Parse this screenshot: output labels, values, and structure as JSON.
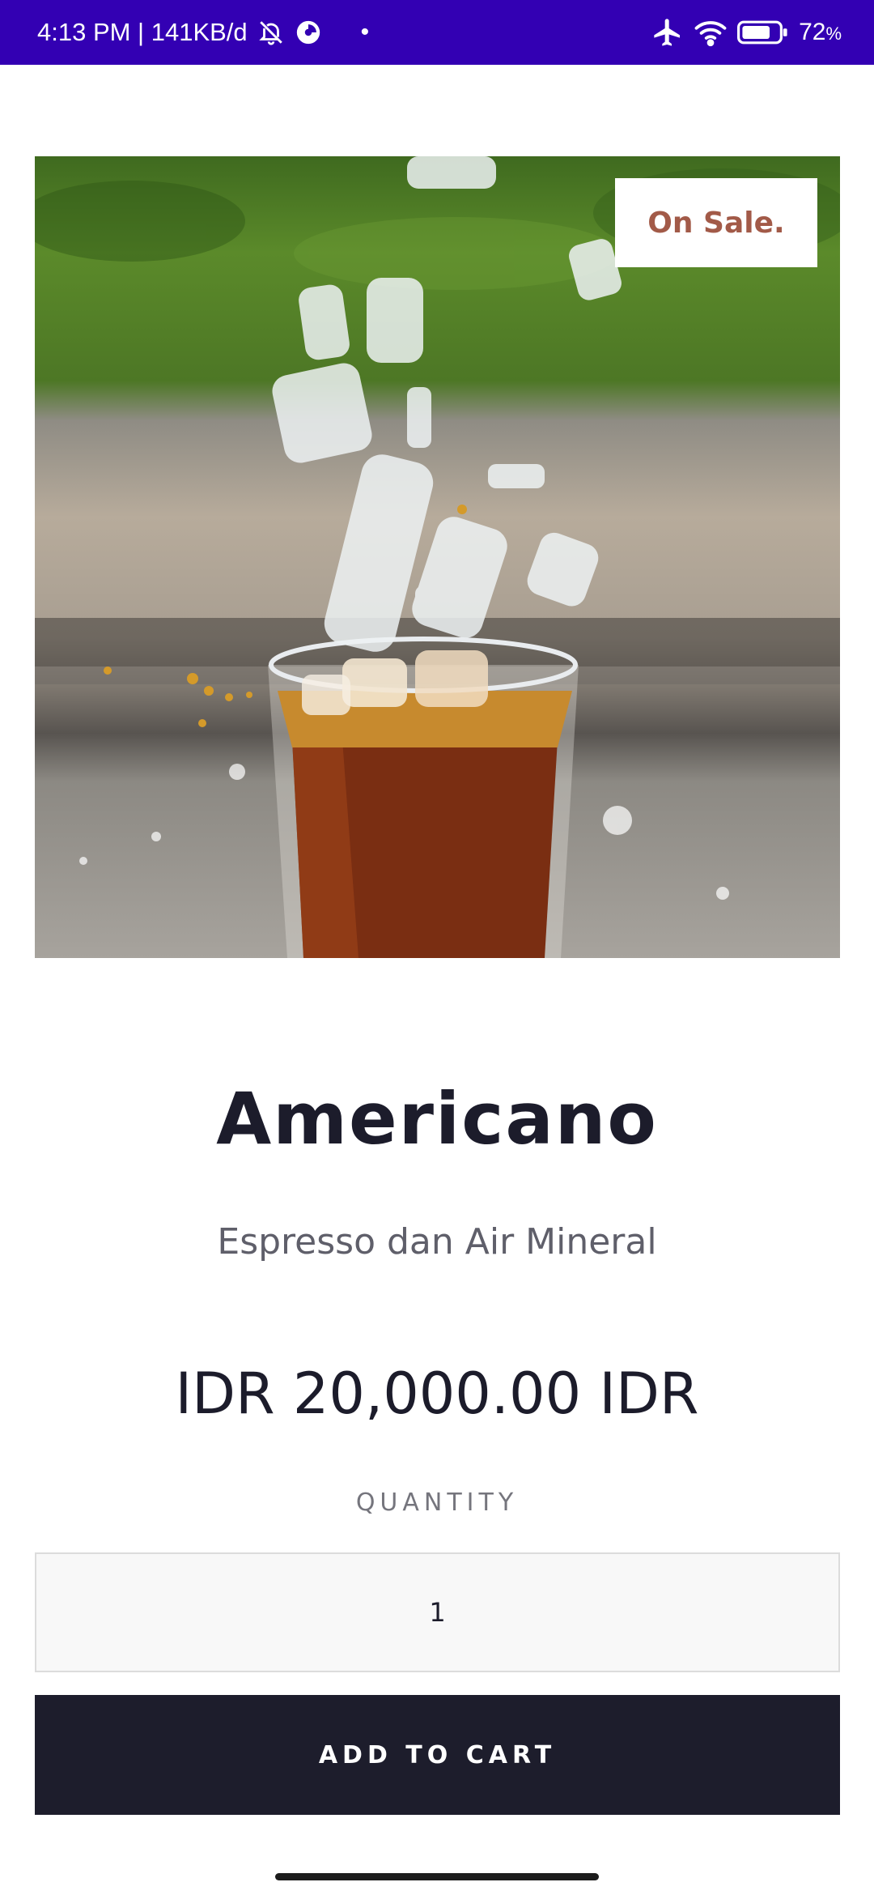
{
  "status_bar": {
    "time_info": "4:13 PM | 141KB/d",
    "dot": "•",
    "battery_percent": "72",
    "battery_unit": "%",
    "icons": [
      "bell-off-icon",
      "data-saver-icon",
      "airplane-icon",
      "wifi-icon",
      "battery-icon"
    ]
  },
  "product": {
    "badge": "On Sale.",
    "name": "Americano",
    "description": "Espresso dan Air Mineral",
    "price": "IDR 20,000.00 IDR",
    "quantity_label": "QUANTITY",
    "quantity_value": "1",
    "add_to_cart_label": "ADD TO CART"
  },
  "colors": {
    "status_bar": "#3300b3",
    "badge_text": "#a25a48",
    "button_bg": "#1d1d2c",
    "text_dark": "#1c1c2b"
  }
}
